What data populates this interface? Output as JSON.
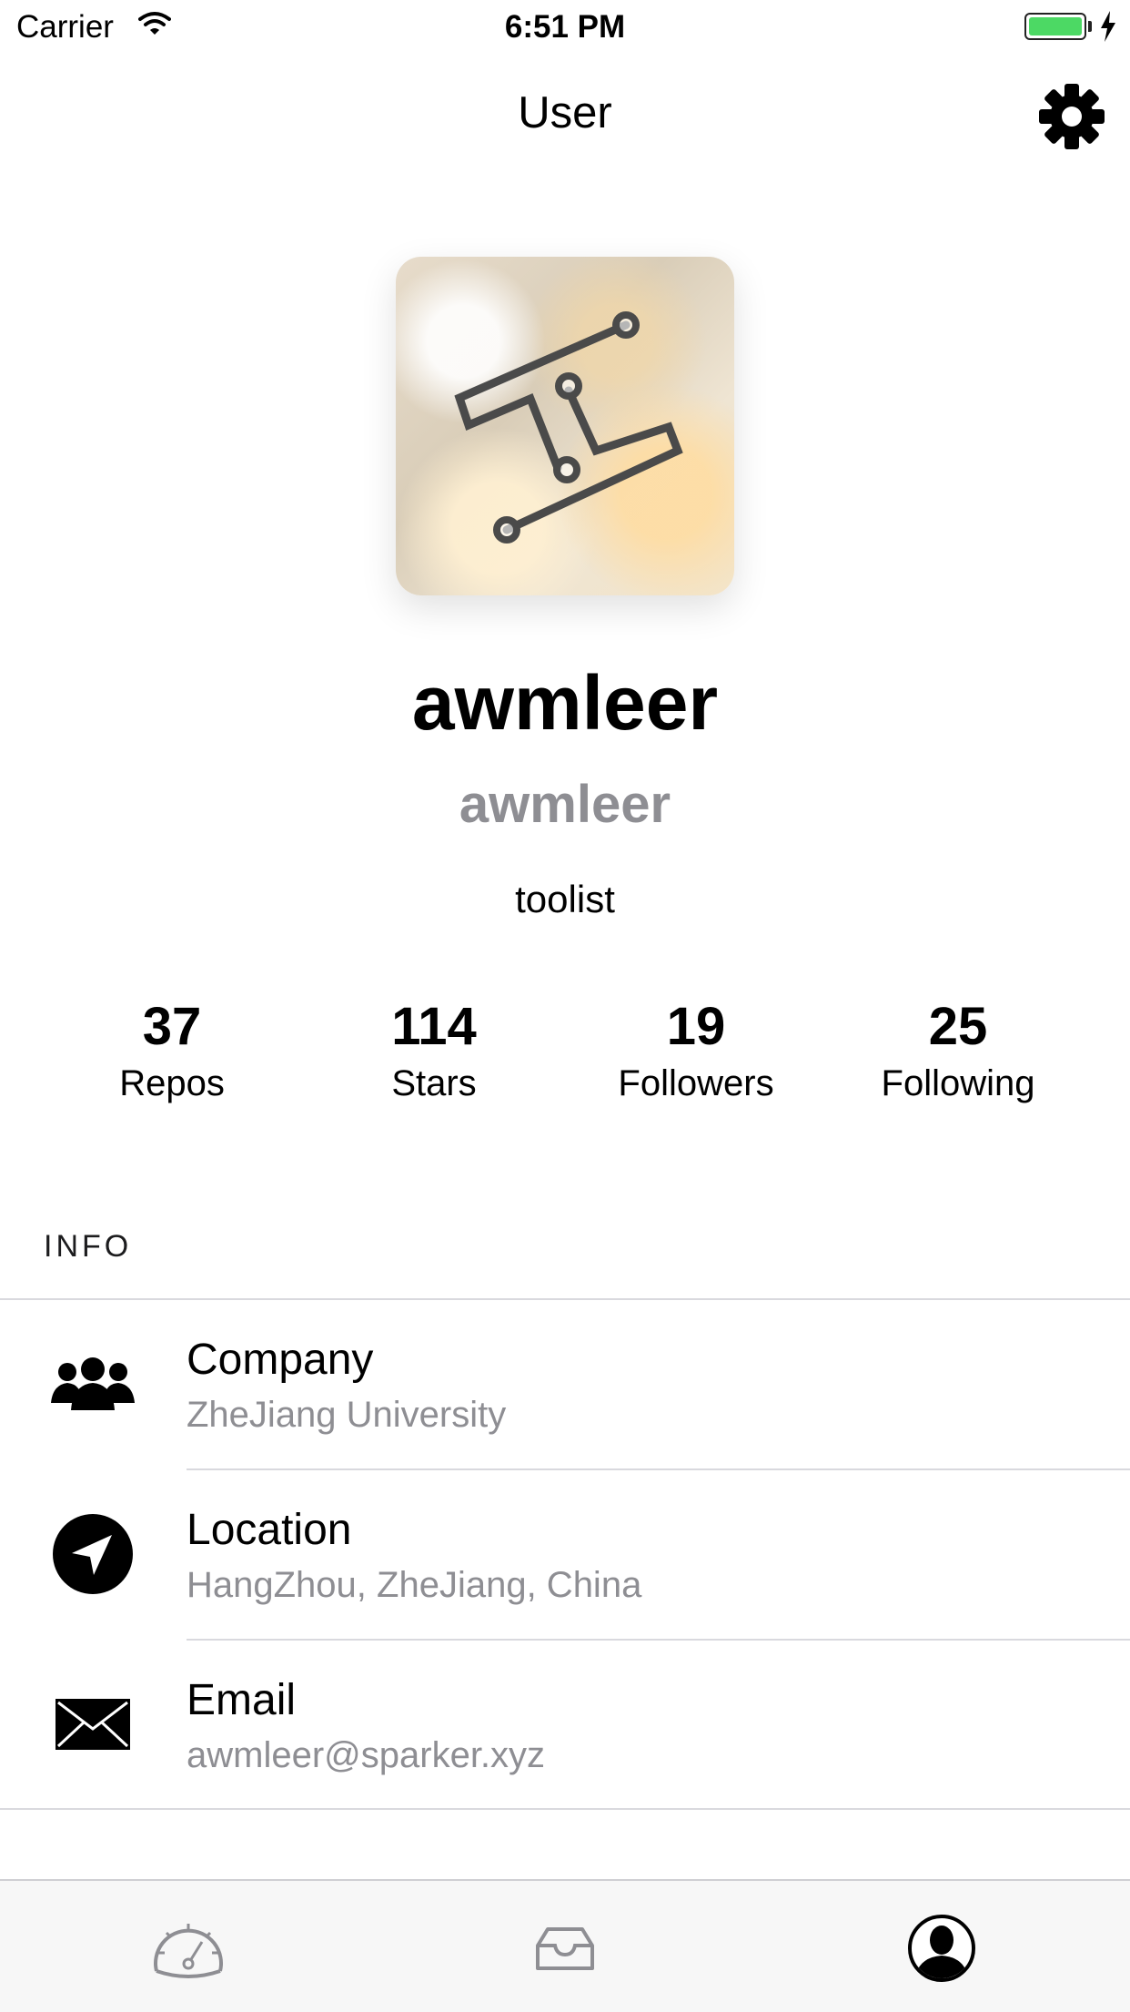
{
  "status_bar": {
    "carrier": "Carrier",
    "time": "6:51 PM",
    "battery_color": "#4cd964"
  },
  "nav": {
    "title": "User",
    "settings_icon": "gear-icon"
  },
  "profile": {
    "avatar_icon": "circuit-logo",
    "display_name": "awmleer",
    "login": "awmleer",
    "bio": "toolist",
    "stats": [
      {
        "value": "37",
        "label": "Repos"
      },
      {
        "value": "114",
        "label": "Stars"
      },
      {
        "value": "19",
        "label": "Followers"
      },
      {
        "value": "25",
        "label": "Following"
      }
    ]
  },
  "info": {
    "header": "INFO",
    "rows": [
      {
        "icon": "group-icon",
        "title": "Company",
        "value": "ZheJiang University"
      },
      {
        "icon": "location-arrow-icon",
        "title": "Location",
        "value": "HangZhou, ZheJiang, China"
      },
      {
        "icon": "envelope-icon",
        "title": "Email",
        "value": "awmleer@sparker.xyz"
      }
    ]
  },
  "tab_bar": {
    "tabs": [
      {
        "icon": "dashboard-icon",
        "selected": false
      },
      {
        "icon": "inbox-icon",
        "selected": false
      },
      {
        "icon": "user-profile-icon",
        "selected": true
      }
    ]
  }
}
